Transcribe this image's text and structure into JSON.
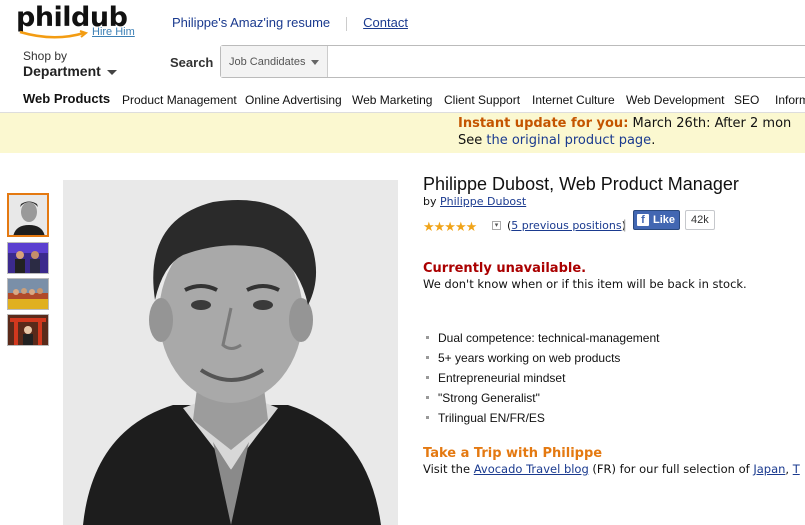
{
  "header": {
    "logo": "phildub",
    "hire_link": "Hire Him",
    "links": [
      "Philippe's Amaz'ing resume",
      "Contact"
    ],
    "shop_by": "Shop by",
    "department": "Department",
    "search_label": "Search",
    "search_category": "Job Candidates",
    "search_value": ""
  },
  "nav": {
    "main": "Web Products",
    "items": [
      "Product Management",
      "Online Advertising",
      "Web Marketing",
      "Client Support",
      "Internet Culture",
      "Web Development",
      "SEO",
      "Inform"
    ]
  },
  "banner": {
    "highlight": "Instant update for you:",
    "line1_rest": " March 26th: After 2 mon",
    "line2_prefix": "See ",
    "line2_link": "the original product page",
    "line2_suffix": "."
  },
  "product": {
    "title": "Philippe Dubost, Web Product Manager",
    "by": "by ",
    "author": "Philippe Dubost",
    "stars": "★★★★★",
    "positions_open": "(",
    "positions_link": "5 previous positions",
    "positions_close": ")",
    "pipe": "|",
    "like_label": "Like",
    "like_count": "42k",
    "availability": "Currently unavailable.",
    "availability_msg": "We don't know when or if this item will be back in stock.",
    "bullets": [
      "Dual competence: technical-management",
      "5+ years working on web products",
      "Entrepreneurial mindset",
      "\"Strong Generalist\"",
      "Trilingual EN/FR/ES"
    ],
    "trip_title": "Take a Trip with Philippe",
    "trip_prefix": "Visit the ",
    "trip_link": "Avocado Travel blog",
    "trip_middle": " (FR) for our full selection of ",
    "trip_city1": "Japan",
    "trip_sep": ", ",
    "trip_city2": "T"
  },
  "colors": {
    "accent_orange": "#e47911",
    "link_blue": "#1a3a8f",
    "unavailable_red": "#aa0000",
    "banner_bg": "#fbf8d0",
    "facebook_blue": "#4267b2"
  }
}
